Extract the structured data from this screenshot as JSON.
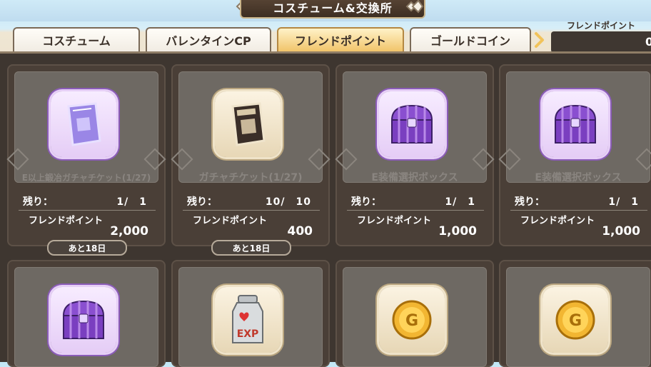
{
  "header": {
    "title": "コスチューム&交換所"
  },
  "tabs": [
    {
      "label": "コスチューム",
      "active": false
    },
    {
      "label": "バレンタインCP",
      "active": false
    },
    {
      "label": "フレンドポイント",
      "active": true
    },
    {
      "label": "ゴールドコイン",
      "active": false
    }
  ],
  "points": {
    "label": "フレンドポイント",
    "value": "0"
  },
  "shop": {
    "stock_label": "残り：",
    "cost_label": "フレンドポイント",
    "items": [
      {
        "name": "E以上鍛冶ガチャチケット(1/27)",
        "stock": "1/　1",
        "cost": "2,000",
        "days": "あと18日",
        "icon": "gacha-ticket-purple-icon"
      },
      {
        "name": "ガチャチケット(1/27)",
        "stock": "10/　10",
        "cost": "400",
        "days": "あと18日",
        "icon": "gacha-ticket-icon"
      },
      {
        "name": "E装備選択ボックス",
        "stock": "1/　1",
        "cost": "1,000",
        "days": "",
        "icon": "treasure-chest-icon"
      },
      {
        "name": "E装備選択ボックス",
        "stock": "1/　1",
        "cost": "1,000",
        "days": "",
        "icon": "treasure-chest-icon"
      },
      {
        "name": "",
        "icon": "treasure-chest-icon"
      },
      {
        "name": "",
        "icon": "exp-milk-can-icon",
        "icon_text": "EXP"
      },
      {
        "name": "",
        "icon": "gold-coin-icon",
        "icon_text": "G"
      },
      {
        "name": "",
        "icon": "gold-coin-icon",
        "icon_text": "G"
      }
    ]
  },
  "colors": {
    "accent_tab": "#f1c46a",
    "panel": "#3e3630",
    "card_inner": "#6e6963"
  }
}
